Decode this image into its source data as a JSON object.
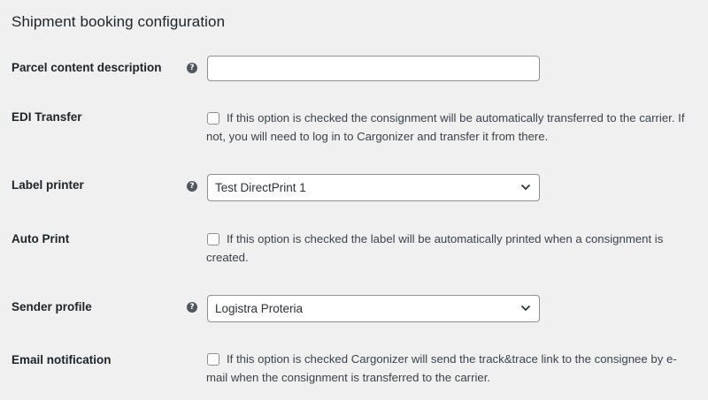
{
  "section": {
    "title": "Shipment booking configuration"
  },
  "rows": {
    "parcel_description": {
      "label": "Parcel content description",
      "help_icon": "question-circle-icon",
      "value": ""
    },
    "edi_transfer": {
      "label": "EDI Transfer",
      "checked": false,
      "description": "If this option is checked the consignment will be automatically transferred to the carrier. If not, you will need to log in to Cargonizer and transfer it from there."
    },
    "label_printer": {
      "label": "Label printer",
      "help_icon": "question-circle-icon",
      "selected": "Test DirectPrint 1"
    },
    "auto_print": {
      "label": "Auto Print",
      "checked": false,
      "description": "If this option is checked the label will be automatically printed when a consignment is created."
    },
    "sender_profile": {
      "label": "Sender profile",
      "help_icon": "question-circle-icon",
      "selected": "Logistra Proteria"
    },
    "email_notification": {
      "label": "Email notification",
      "checked": false,
      "description": "If this option is checked Cargonizer will send the track&trace link to the consignee by e-mail when the consignment is transferred to the carrier."
    }
  },
  "help_glyph": "?",
  "colors": {
    "background": "#f0f0f1",
    "text": "#1d2327",
    "border": "#8c8f94",
    "help_icon": "#50575e"
  }
}
